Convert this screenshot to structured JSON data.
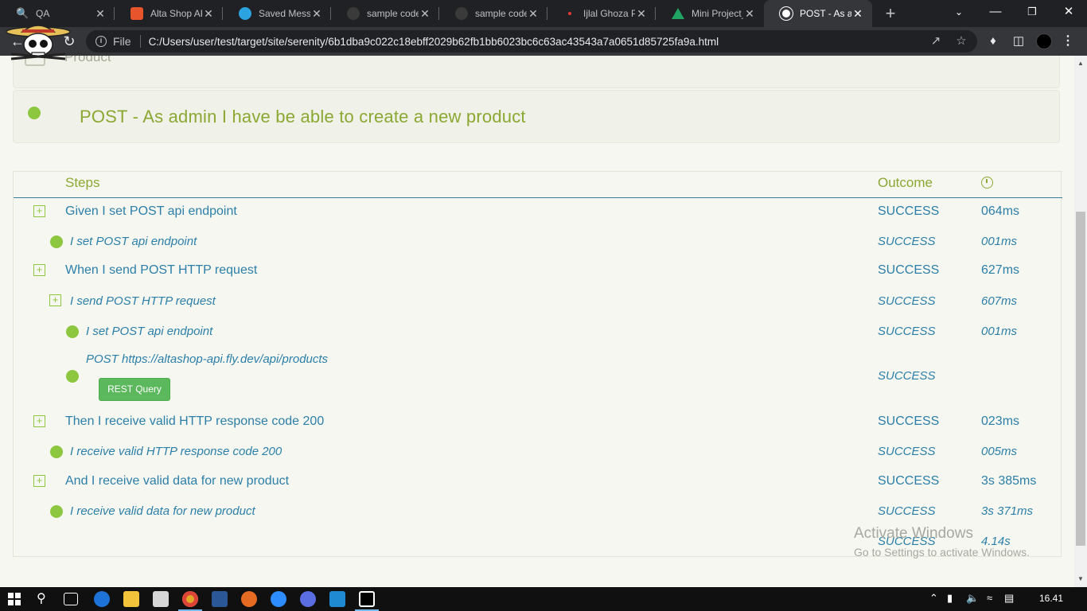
{
  "browser": {
    "tabs": [
      {
        "label": "QA",
        "favicon_color": "#4b5dad"
      },
      {
        "label": "Alta Shop API",
        "favicon_color": "#e8542c"
      },
      {
        "label": "Saved Messag",
        "favicon_color": "#2aa3df"
      },
      {
        "label": "sample codes",
        "favicon_color": "#3a3a3a"
      },
      {
        "label": "sample codes",
        "favicon_color": "#3a3a3a"
      },
      {
        "label": "Ijlal Ghoza Pu",
        "favicon_color": "#e53935"
      },
      {
        "label": "Mini Project_(",
        "favicon_color": "#1fa463"
      },
      {
        "label": "POST - As adr",
        "favicon_color": "#ffffff",
        "active": true
      }
    ],
    "address": {
      "scheme_label": "File",
      "url": "C:/Users/user/test/target/site/serenity/6b1dba9c022c18ebff2029b62fb1bb6023bc6c63ac43543a7a0651d85725fa9a.html"
    }
  },
  "report": {
    "breadcrumb": "Product",
    "scenario_title": "POST - As admin I have be able to create a new product",
    "headers": {
      "steps": "Steps",
      "outcome": "Outcome"
    },
    "steps": [
      {
        "description": "Given I set POST api endpoint",
        "outcome": "SUCCESS",
        "duration": "064ms",
        "level": 0,
        "icon": "expand"
      },
      {
        "description": "I set POST api endpoint",
        "outcome": "SUCCESS",
        "duration": "001ms",
        "level": 1,
        "icon": "check"
      },
      {
        "description": "When I send POST HTTP request",
        "outcome": "SUCCESS",
        "duration": "627ms",
        "level": 0,
        "icon": "expand"
      },
      {
        "description": "I send POST HTTP request",
        "outcome": "SUCCESS",
        "duration": "607ms",
        "level": 1,
        "icon": "expand"
      },
      {
        "description": "I set POST api endpoint",
        "outcome": "SUCCESS",
        "duration": "001ms",
        "level": 2,
        "icon": "check"
      },
      {
        "description": "POST https://altashop-api.fly.dev/api/products",
        "outcome": "SUCCESS",
        "duration": "",
        "level": 2,
        "icon": "check",
        "button": "REST Query"
      },
      {
        "description": "Then I receive valid HTTP response code 200",
        "outcome": "SUCCESS",
        "duration": "023ms",
        "level": 0,
        "icon": "expand"
      },
      {
        "description": "I receive valid HTTP response code 200",
        "outcome": "SUCCESS",
        "duration": "005ms",
        "level": 1,
        "icon": "check"
      },
      {
        "description": "And I receive valid data for new product",
        "outcome": "SUCCESS",
        "duration": "3s 385ms",
        "level": 0,
        "icon": "expand"
      },
      {
        "description": "I receive valid data for new product",
        "outcome": "SUCCESS",
        "duration": "3s 371ms",
        "level": 1,
        "icon": "check"
      }
    ],
    "total": {
      "outcome": "SUCCESS",
      "duration": "4.14s"
    }
  },
  "watermark": {
    "line1": "Activate Windows",
    "line2": "Go to Settings to activate Windows."
  },
  "taskbar": {
    "clock": "16.41"
  }
}
